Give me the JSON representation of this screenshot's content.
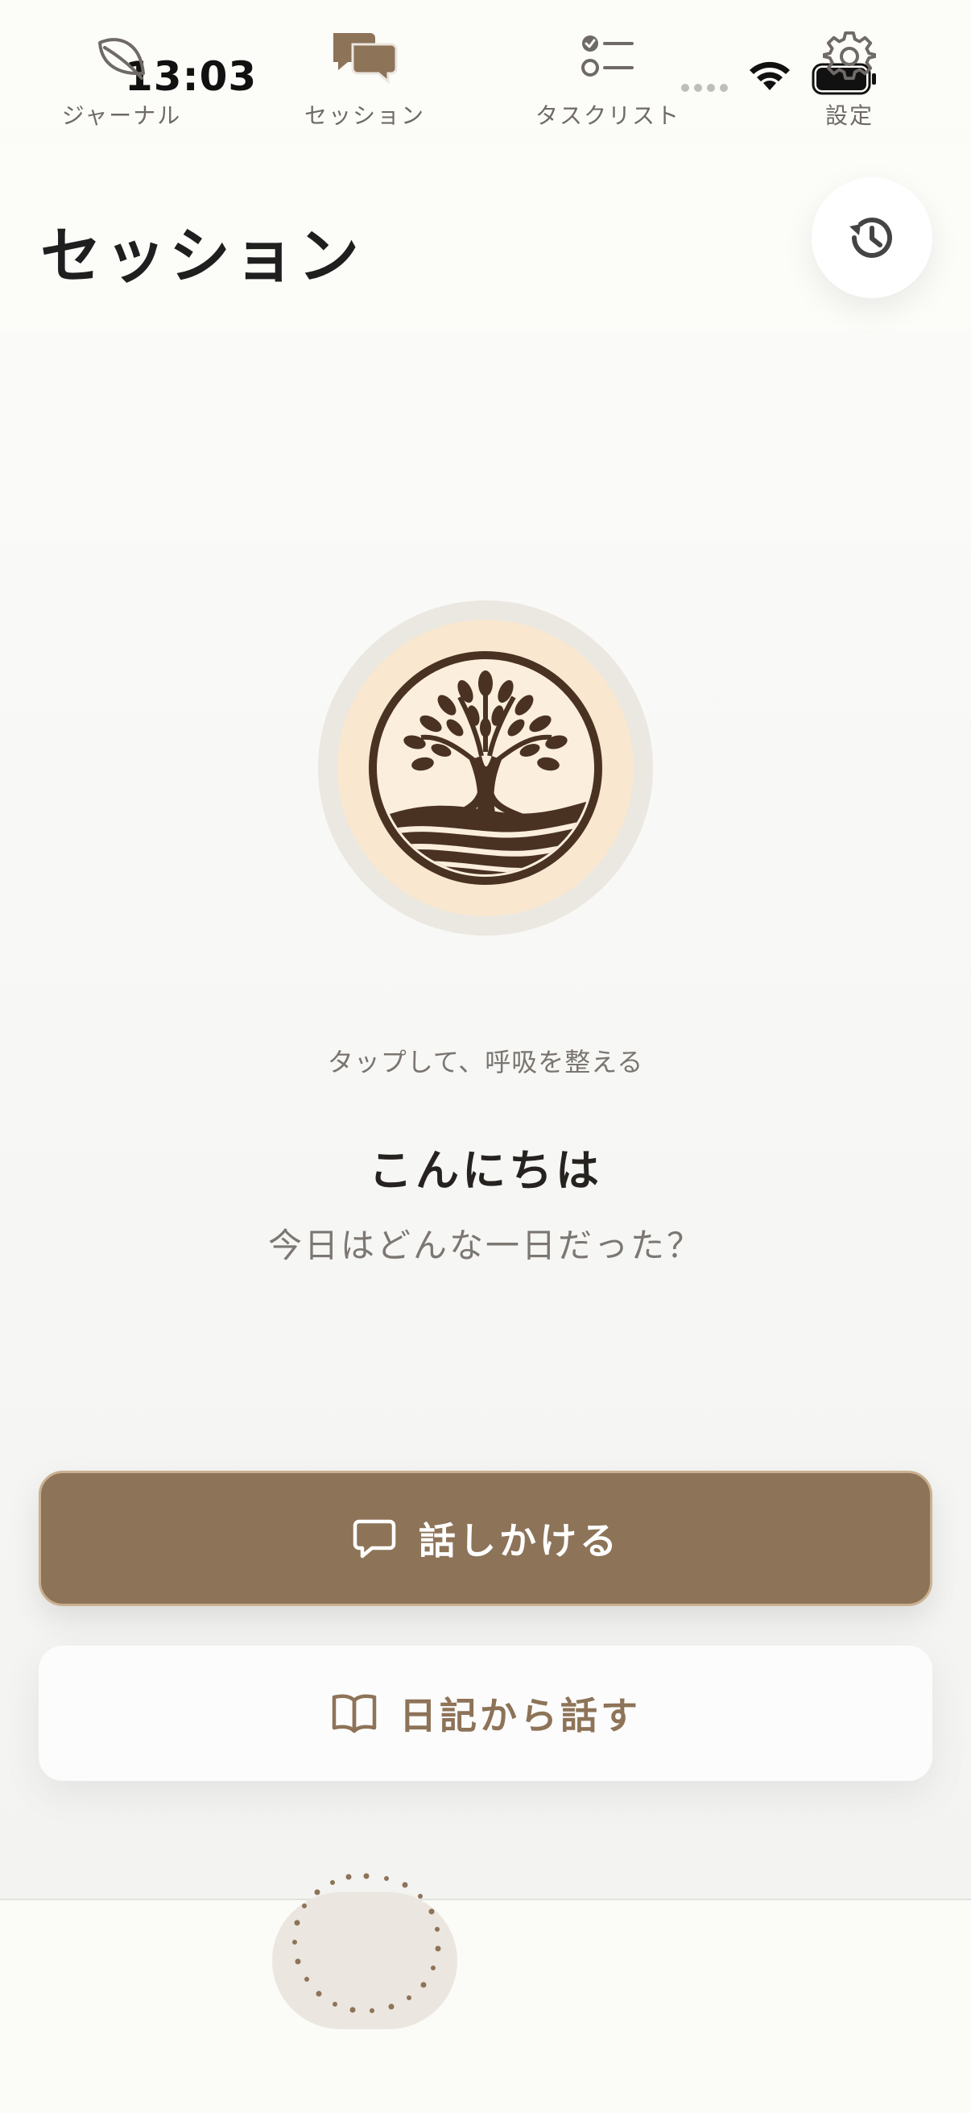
{
  "status_bar": {
    "time": "13:03"
  },
  "header": {
    "title": "セッション",
    "history_icon": "history-icon"
  },
  "main": {
    "tap_hint": "タップして、呼吸を整える",
    "greeting": "こんにちは",
    "subtitle": "今日はどんな一日だった？"
  },
  "actions": {
    "talk_label": "話しかける",
    "talk_icon": "chat-bubble-icon",
    "diary_label": "日記から話す",
    "diary_icon": "open-book-icon"
  },
  "tabbar": {
    "active": "セッション",
    "items": [
      {
        "label": "ジャーナル",
        "icon": "leaf-icon"
      },
      {
        "label": "セッション",
        "icon": "chat-bubbles-icon"
      },
      {
        "label": "タスクリスト",
        "icon": "checklist-icon"
      },
      {
        "label": "設定",
        "icon": "gear-icon"
      }
    ]
  },
  "colors": {
    "accent": "#8d7358",
    "logo_dark": "#4a3222",
    "logo_bg": "#f9e8cf",
    "background": "#fafaf8"
  }
}
